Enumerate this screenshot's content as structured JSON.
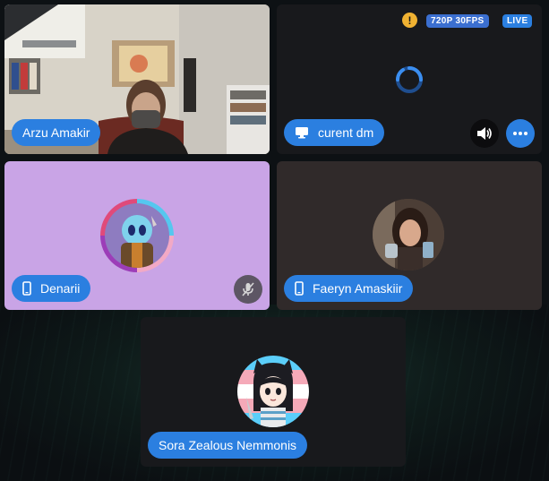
{
  "participants": {
    "arzu": {
      "name": "Arzu Amakir",
      "tile_color": "#3b3532"
    },
    "stream": {
      "name": "curent dm",
      "quality_badge": "720P 30FPS",
      "live_badge": "LIVE",
      "warning_icon": "warning-icon",
      "tile_color": "#18191c"
    },
    "denarii": {
      "name": "Denarii",
      "tile_color": "#c9a4e6",
      "device_icon": "mobile-icon",
      "status_icon": "muted-mic-icon"
    },
    "faeryn": {
      "name": "Faeryn Amaskiir",
      "tile_color": "#302a2a",
      "device_icon": "mobile-icon"
    },
    "sora": {
      "name": "Sora Zealous Nemmonis",
      "tile_color": "#18191c"
    }
  },
  "colors": {
    "accent": "#2b7fe0",
    "warning": "#f0b232",
    "background": "#0d1114"
  }
}
